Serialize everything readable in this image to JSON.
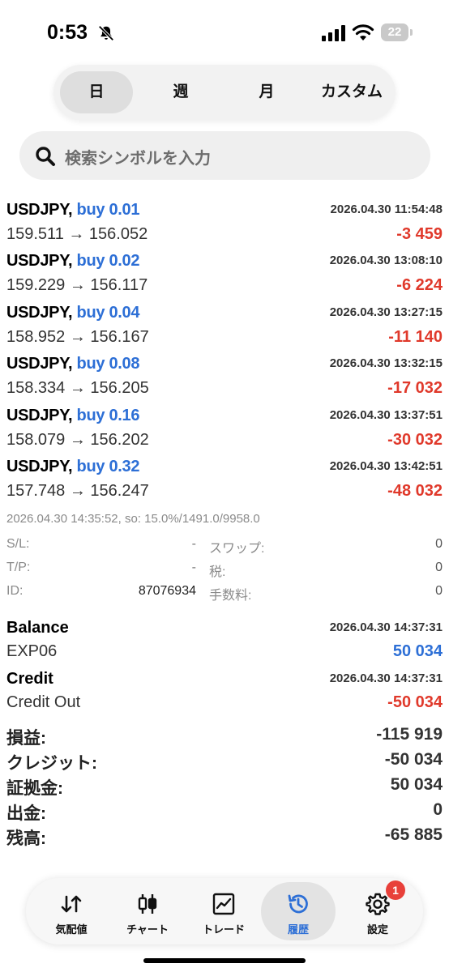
{
  "status_bar": {
    "time": "0:53",
    "battery": "22"
  },
  "periods": [
    {
      "label": "日",
      "active": true
    },
    {
      "label": "週",
      "active": false
    },
    {
      "label": "月",
      "active": false
    },
    {
      "label": "カスタム",
      "active": false
    }
  ],
  "search": {
    "placeholder": "検索シンボルを入力"
  },
  "deals": [
    {
      "symbol": "USDJPY,",
      "side": "buy 0.01",
      "time": "2026.04.30 11:54:48",
      "prices": "159.511 → 156.052",
      "profit": "-3 459"
    },
    {
      "symbol": "USDJPY,",
      "side": "buy 0.02",
      "time": "2026.04.30 13:08:10",
      "prices": "159.229 → 156.117",
      "profit": "-6 224"
    },
    {
      "symbol": "USDJPY,",
      "side": "buy 0.04",
      "time": "2026.04.30 13:27:15",
      "prices": "158.952 → 156.167",
      "profit": "-11 140"
    },
    {
      "symbol": "USDJPY,",
      "side": "buy 0.08",
      "time": "2026.04.30 13:32:15",
      "prices": "158.334 → 156.205",
      "profit": "-17 032"
    },
    {
      "symbol": "USDJPY,",
      "side": "buy 0.16",
      "time": "2026.04.30 13:37:51",
      "prices": "158.079 → 156.202",
      "profit": "-30 032"
    },
    {
      "symbol": "USDJPY,",
      "side": "buy 0.32",
      "time": "2026.04.30 13:42:51",
      "prices": "157.748 → 156.247",
      "profit": "-48 032"
    }
  ],
  "detail": {
    "header": "2026.04.30 14:35:52, so: 15.0%/1491.0/9958.0",
    "rows": [
      {
        "label": "S/L:",
        "value": "-",
        "label2": "スワップ:",
        "value2": "0"
      },
      {
        "label": "T/P:",
        "value": "-",
        "label2": "税:",
        "value2": "0"
      },
      {
        "label": "ID:",
        "value": "87076934",
        "label2": "手数料:",
        "value2": "0"
      }
    ]
  },
  "operations": [
    {
      "type": "Balance",
      "time": "2026.04.30 14:37:31",
      "comment": "EXP06",
      "amount": "50 034",
      "color": "#2d6fd6"
    },
    {
      "type": "Credit",
      "time": "2026.04.30 14:37:31",
      "comment": "Credit Out",
      "amount": "-50 034",
      "color": "#e0392b"
    }
  ],
  "summary": [
    {
      "label": "損益:",
      "value": "-115 919"
    },
    {
      "label": "クレジット:",
      "value": "-50 034"
    },
    {
      "label": "証拠金:",
      "value": "50 034"
    },
    {
      "label": "出金:",
      "value": "0"
    },
    {
      "label": "残高:",
      "value": "-65 885"
    }
  ],
  "nav": [
    {
      "label": "気配値",
      "icon": "quotes-arrows-icon",
      "active": false
    },
    {
      "label": "チャート",
      "icon": "candlestick-chart-icon",
      "active": false
    },
    {
      "label": "トレード",
      "icon": "trade-line-chart-icon",
      "active": false
    },
    {
      "label": "履歴",
      "icon": "history-clock-icon",
      "active": true
    },
    {
      "label": "設定",
      "icon": "gear-icon",
      "active": false,
      "badge": "1"
    }
  ],
  "colors": {
    "accent": "#2d6fd6",
    "loss": "#e0392b"
  }
}
